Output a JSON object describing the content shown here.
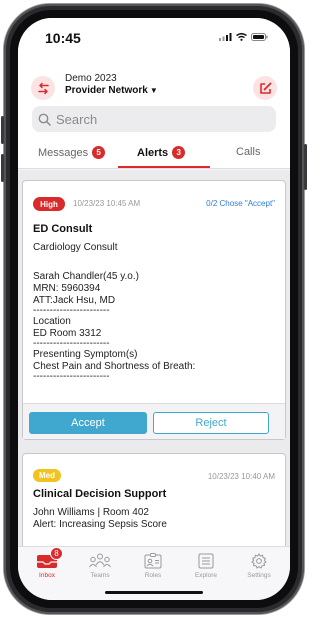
{
  "status_bar": {
    "time": "10:45"
  },
  "header": {
    "org_name": "Demo 2023",
    "network": "Provider Network",
    "search_placeholder": "Search"
  },
  "tabs": [
    {
      "label": "Messages",
      "badge": "5"
    },
    {
      "label": "Alerts",
      "badge": "3",
      "active": true
    },
    {
      "label": "Calls"
    }
  ],
  "alerts": [
    {
      "priority": "High",
      "time": "10/23/23 10:45 AM",
      "status": "0/2 Chose \"Accept\"",
      "title": "ED Consult",
      "lines": [
        "Cardiology Consult",
        "",
        "Sarah Chandler(45 y.o.)",
        "MRN: 5960394",
        "ATT:Jack Hsu, MD",
        "-----------------------",
        "Location",
        "ED Room 3312",
        "-----------------------",
        "Presenting Symptom(s)",
        "Chest Pain and Shortness of Breath:",
        "-----------------------"
      ],
      "accept_label": "Accept",
      "reject_label": "Reject"
    },
    {
      "priority": "Med",
      "time": "10/23/23 10:40 AM",
      "title": "Clinical Decision Support",
      "lines": [
        "John Williams | Room 402",
        "Alert: Increasing Sepsis Score"
      ]
    }
  ],
  "bottom_nav": [
    {
      "label": "Inbox",
      "icon": "inbox-icon",
      "badge": "8",
      "active": true
    },
    {
      "label": "Teams",
      "icon": "teams-icon"
    },
    {
      "label": "Roles",
      "icon": "roles-icon"
    },
    {
      "label": "Explore",
      "icon": "explore-icon"
    },
    {
      "label": "Settings",
      "icon": "settings-icon"
    }
  ],
  "colors": {
    "accent": "#d92b2b",
    "button": "#40a8cf",
    "link": "#2f7fd1",
    "med": "#f2c21d"
  }
}
